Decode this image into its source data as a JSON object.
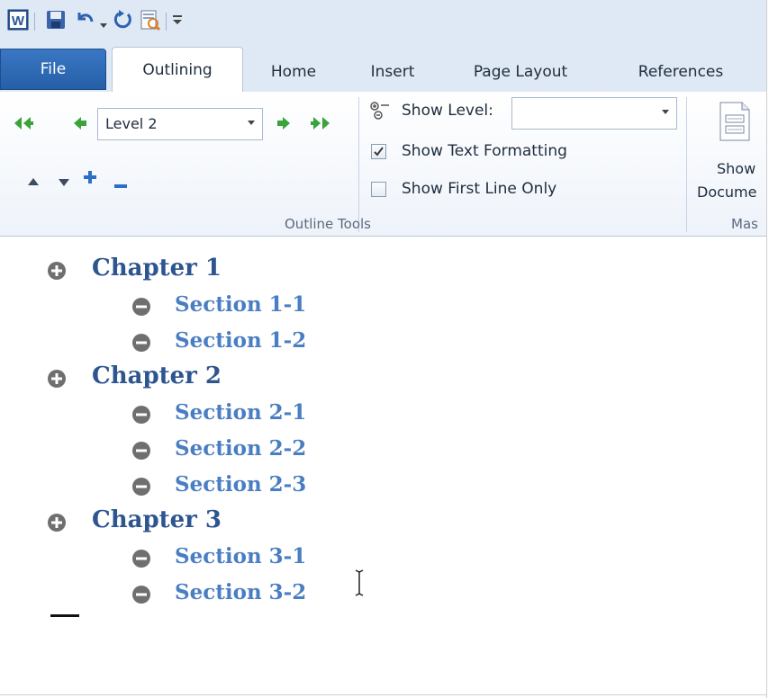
{
  "quick_access": {
    "items": [
      "word-app-icon",
      "save-icon",
      "undo-icon",
      "redo-icon",
      "print-preview-icon",
      "customize-qat-icon"
    ]
  },
  "tabs": {
    "file": "File",
    "outlining": "Outlining",
    "home": "Home",
    "insert": "Insert",
    "page_layout": "Page Layout",
    "references": "References"
  },
  "ribbon": {
    "outline_tools": {
      "group_label": "Outline Tools",
      "level_value": "Level 2",
      "show_level_label": "Show Level:",
      "show_level_value": "",
      "show_text_formatting": {
        "label": "Show Text Formatting",
        "checked": true
      },
      "show_first_line_only": {
        "label": "Show First Line Only",
        "checked": false
      }
    },
    "master_document": {
      "button_line1": "Show",
      "button_line2": "Docume",
      "group_label": "Mas"
    }
  },
  "document": {
    "outline": [
      {
        "level": 1,
        "text": "Chapter 1",
        "icon": "plus-circle-icon"
      },
      {
        "level": 2,
        "text": "Section 1-1",
        "icon": "minus-circle-icon"
      },
      {
        "level": 2,
        "text": "Section 1-2",
        "icon": "minus-circle-icon"
      },
      {
        "level": 1,
        "text": "Chapter 2",
        "icon": "plus-circle-icon"
      },
      {
        "level": 2,
        "text": "Section 2-1",
        "icon": "minus-circle-icon"
      },
      {
        "level": 2,
        "text": "Section 2-2",
        "icon": "minus-circle-icon"
      },
      {
        "level": 2,
        "text": "Section 2-3",
        "icon": "minus-circle-icon"
      },
      {
        "level": 1,
        "text": "Chapter 3",
        "icon": "plus-circle-icon"
      },
      {
        "level": 2,
        "text": "Section 3-1",
        "icon": "minus-circle-icon"
      },
      {
        "level": 2,
        "text": "Section 3-2",
        "icon": "minus-circle-icon"
      }
    ]
  },
  "colors": {
    "chapter_text": "#2d5590",
    "section_text": "#4a7ec3",
    "file_tab": "#2f6cb8",
    "ribbon_bg": "#dfe9f5"
  }
}
